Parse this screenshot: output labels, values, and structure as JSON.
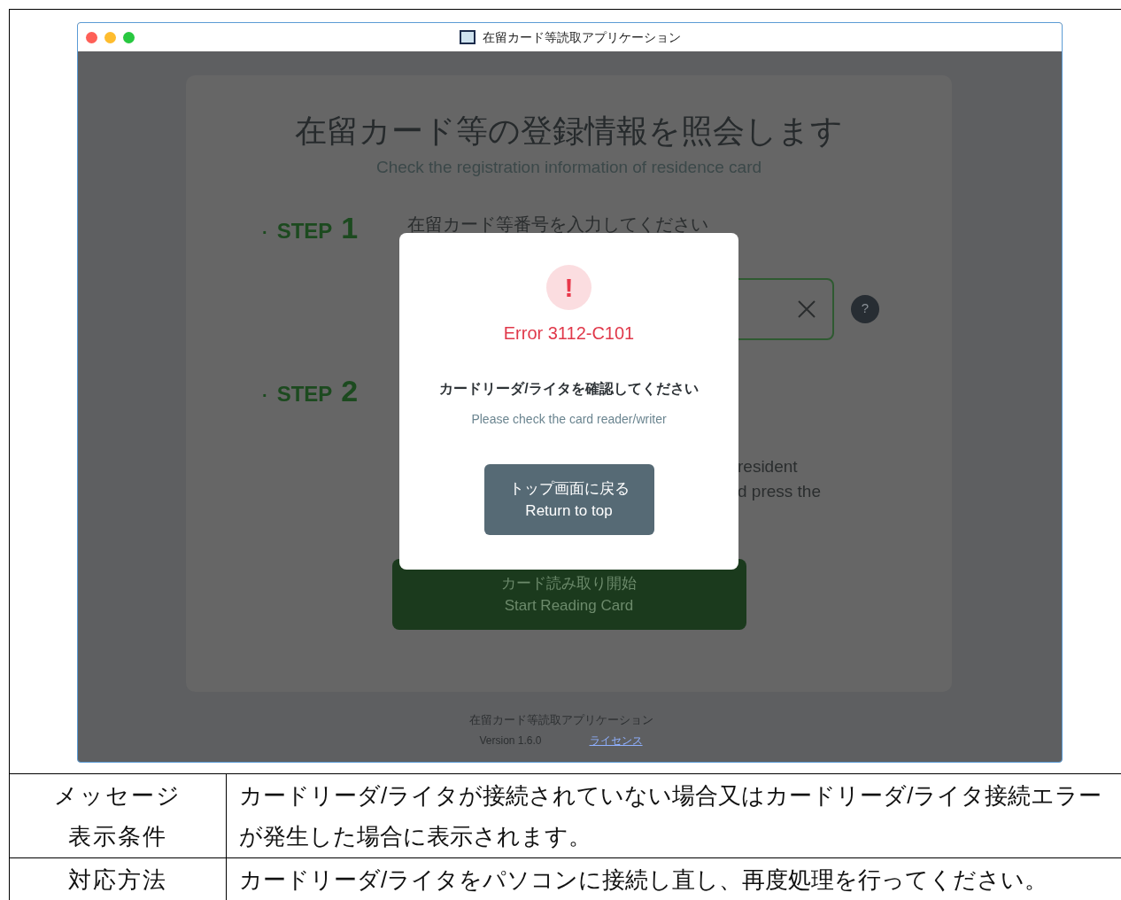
{
  "screenshot": {
    "window": {
      "title": "在留カード等読取アプリケーション"
    },
    "page": {
      "heading": "在留カード等の登録情報を照会します",
      "subheading": "Check the registration information of residence card",
      "steps": [
        {
          "bullet": "·",
          "label": "STEP",
          "number": "1",
          "text": "在留カード等番号を入力してください"
        },
        {
          "bullet": "·",
          "label": "STEP",
          "number": "2"
        }
      ],
      "help_icon": "?",
      "fragments": [
        "resident",
        "d press the"
      ],
      "start_button": {
        "label_ja": "カード読み取り開始",
        "label_en": "Start Reading Card"
      },
      "footer": {
        "app_name": "在留カード等読取アプリケーション",
        "version": "Version 1.6.0",
        "license_link": "ライセンス"
      }
    },
    "dialog": {
      "icon": "!",
      "code": "Error 3112-C101",
      "message_ja": "カードリーダ/ライタを確認してください",
      "message_en": "Please check the card reader/writer",
      "button": {
        "label_ja": "トップ画面に戻る",
        "label_en": "Return to top"
      }
    }
  },
  "table": {
    "rows": [
      {
        "header": "メッセージ表示条件",
        "text": "カードリーダ/ライタが接続されていない場合又はカードリーダ/ライタ接続エラーが発生した場合に表示されます。"
      },
      {
        "header": "対応方法",
        "text": "カードリーダ/ライタをパソコンに接続し直し、再度処理を行ってください。"
      }
    ]
  }
}
